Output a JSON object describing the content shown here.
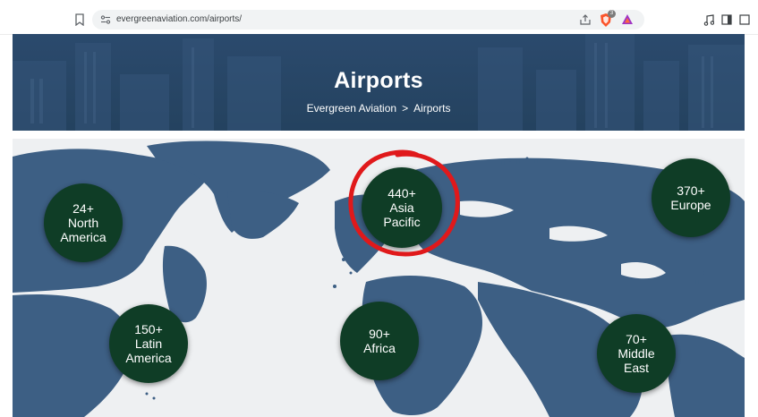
{
  "browser": {
    "url": "evergreenaviation.com/airports/",
    "shield_badge": "3"
  },
  "hero": {
    "title": "Airports",
    "breadcrumb_home": "Evergreen Aviation",
    "breadcrumb_separator": ">",
    "breadcrumb_current": "Airports"
  },
  "regions": [
    {
      "count": "24+",
      "line1": "North",
      "line2": "America"
    },
    {
      "count": "440+",
      "line1": "Asia",
      "line2": "Pacific"
    },
    {
      "count": "370+",
      "line1": "Europe",
      "line2": ""
    },
    {
      "count": "150+",
      "line1": "Latin",
      "line2": "America"
    },
    {
      "count": "90+",
      "line1": "Africa",
      "line2": ""
    },
    {
      "count": "70+",
      "line1": "Middle",
      "line2": "East"
    }
  ],
  "colors": {
    "hero_bg": "#2b4a6d",
    "map_land": "#3d5f84",
    "map_water": "#eef0f2",
    "circle_bg": "#0f3d26",
    "annotation": "#e0191b"
  }
}
